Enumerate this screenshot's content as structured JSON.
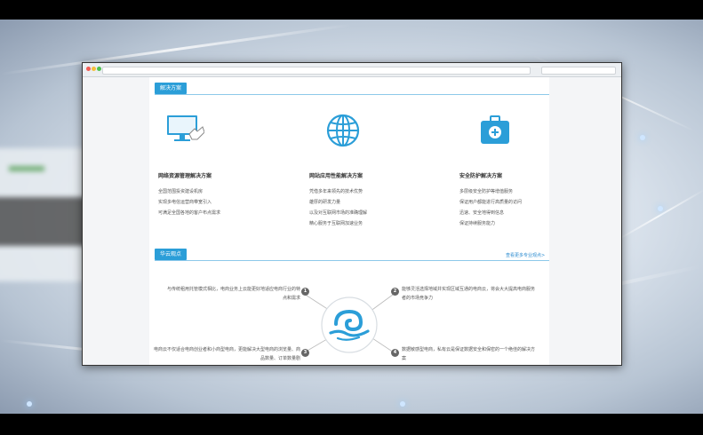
{
  "solutions_section": {
    "tab_label": "解决方案",
    "items": [
      {
        "icon": "monitor-hand-icon",
        "title": "网络资源管理解决方案",
        "lines": [
          "全国范围投资建设机房",
          "实现多电信运营商带宽引入",
          "可满足全国各地的客户布点需求"
        ]
      },
      {
        "icon": "globe-icon",
        "title": "网站应用性能解决方案",
        "lines": [
          "凭借多年来领先的技术优势",
          "雄厚的研发力量",
          "以及对互联网市场的准确理解",
          "精心服务于互联网加速业务"
        ]
      },
      {
        "icon": "medical-kit-icon",
        "title": "安全防护解决方案",
        "lines": [
          "多层级安全防护等增值服务",
          "保证用户都能进行高质量的访问",
          "迅速、安全地得到信息",
          "保证持续服务能力"
        ]
      }
    ]
  },
  "viewpoints_section": {
    "tab_label": "华云观点",
    "more_link": "查看更多专业观点>",
    "points": [
      {
        "num": "1",
        "text": "与传统租用托管模式相比，电商业务上云能更好地适应电商行业的特点和需求"
      },
      {
        "num": "2",
        "text": "能够灵活选择地域并实现区域互通的电商云，将会大大提高电商服务者的市场竞争力"
      },
      {
        "num": "3",
        "text": "电商云不仅适合电商创业者和小商型电商，更能解决大型电商的浏览量、商品数量、订单数量剧"
      },
      {
        "num": "4",
        "text": "数据敏感型电商，私有云是保证数据安全和保密的一个绝佳的解决方案"
      }
    ],
    "center_logo": "huayun-logo-icon"
  },
  "colors": {
    "accent": "#2b9ed8",
    "line": "#8dc9ea",
    "badge": "#666666"
  }
}
